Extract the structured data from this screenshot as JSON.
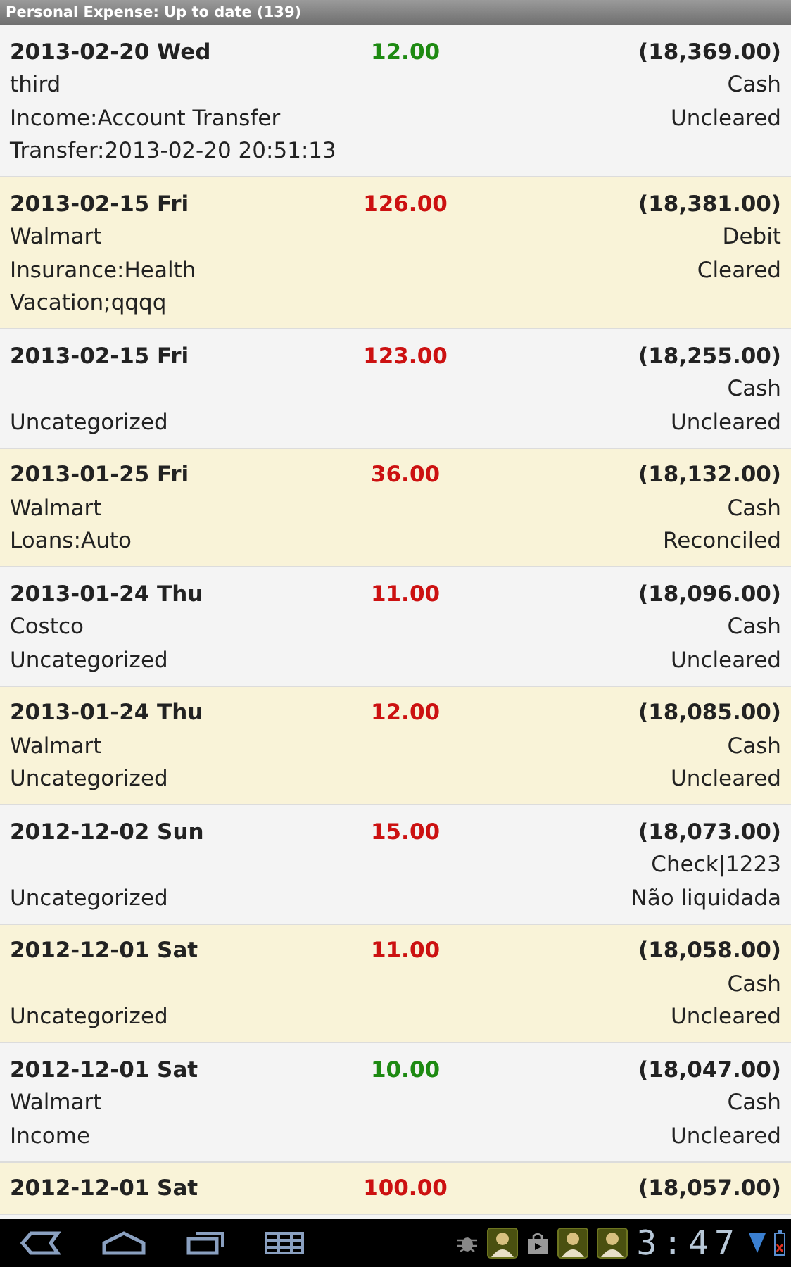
{
  "title_bar": {
    "title": "Personal Expense: Up to date (139)"
  },
  "transactions": [
    {
      "date": "2013-02-20 Wed",
      "amount": "12.00",
      "color": "#1e8a12",
      "balance": "(18,369.00)",
      "payee": "third",
      "account": "Cash",
      "category": "Income:Account Transfer",
      "status": "Uncleared",
      "memo": "Transfer:2013-02-20 20:51:13"
    },
    {
      "date": "2013-02-15 Fri",
      "amount": "126.00",
      "color": "#cc1111",
      "balance": "(18,381.00)",
      "payee": "Walmart",
      "account": "Debit",
      "category": "Insurance:Health",
      "status": "Cleared",
      "memo": "Vacation;qqqq"
    },
    {
      "date": "2013-02-15 Fri",
      "amount": "123.00",
      "color": "#cc1111",
      "balance": "(18,255.00)",
      "account": "Cash",
      "category": "Uncategorized",
      "status": "Uncleared"
    },
    {
      "date": "2013-01-25 Fri",
      "amount": "36.00",
      "color": "#cc1111",
      "balance": "(18,132.00)",
      "payee": "Walmart",
      "account": "Cash",
      "category": "Loans:Auto",
      "status": "Reconciled"
    },
    {
      "date": "2013-01-24 Thu",
      "amount": "11.00",
      "color": "#cc1111",
      "balance": "(18,096.00)",
      "payee": "Costco",
      "account": "Cash",
      "category": "Uncategorized",
      "status": "Uncleared"
    },
    {
      "date": "2013-01-24 Thu",
      "amount": "12.00",
      "color": "#cc1111",
      "balance": "(18,085.00)",
      "payee": "Walmart",
      "account": "Cash",
      "category": "Uncategorized",
      "status": "Uncleared"
    },
    {
      "date": "2012-12-02 Sun",
      "amount": "15.00",
      "color": "#cc1111",
      "balance": "(18,073.00)",
      "account": "Check|1223",
      "category": "Uncategorized",
      "status": "Não liquidada"
    },
    {
      "date": "2012-12-01 Sat",
      "amount": "11.00",
      "color": "#cc1111",
      "balance": "(18,058.00)",
      "account": "Cash",
      "category": "Uncategorized",
      "status": "Uncleared"
    },
    {
      "date": "2012-12-01 Sat",
      "amount": "10.00",
      "color": "#1e8a12",
      "balance": "(18,047.00)",
      "payee": "Walmart",
      "account": "Cash",
      "category": "Income",
      "status": "Uncleared"
    },
    {
      "date": "2012-12-01 Sat",
      "amount": "100.00",
      "color": "#cc1111",
      "balance": "(18,057.00)"
    }
  ],
  "system_bar": {
    "clock": "3:47"
  }
}
